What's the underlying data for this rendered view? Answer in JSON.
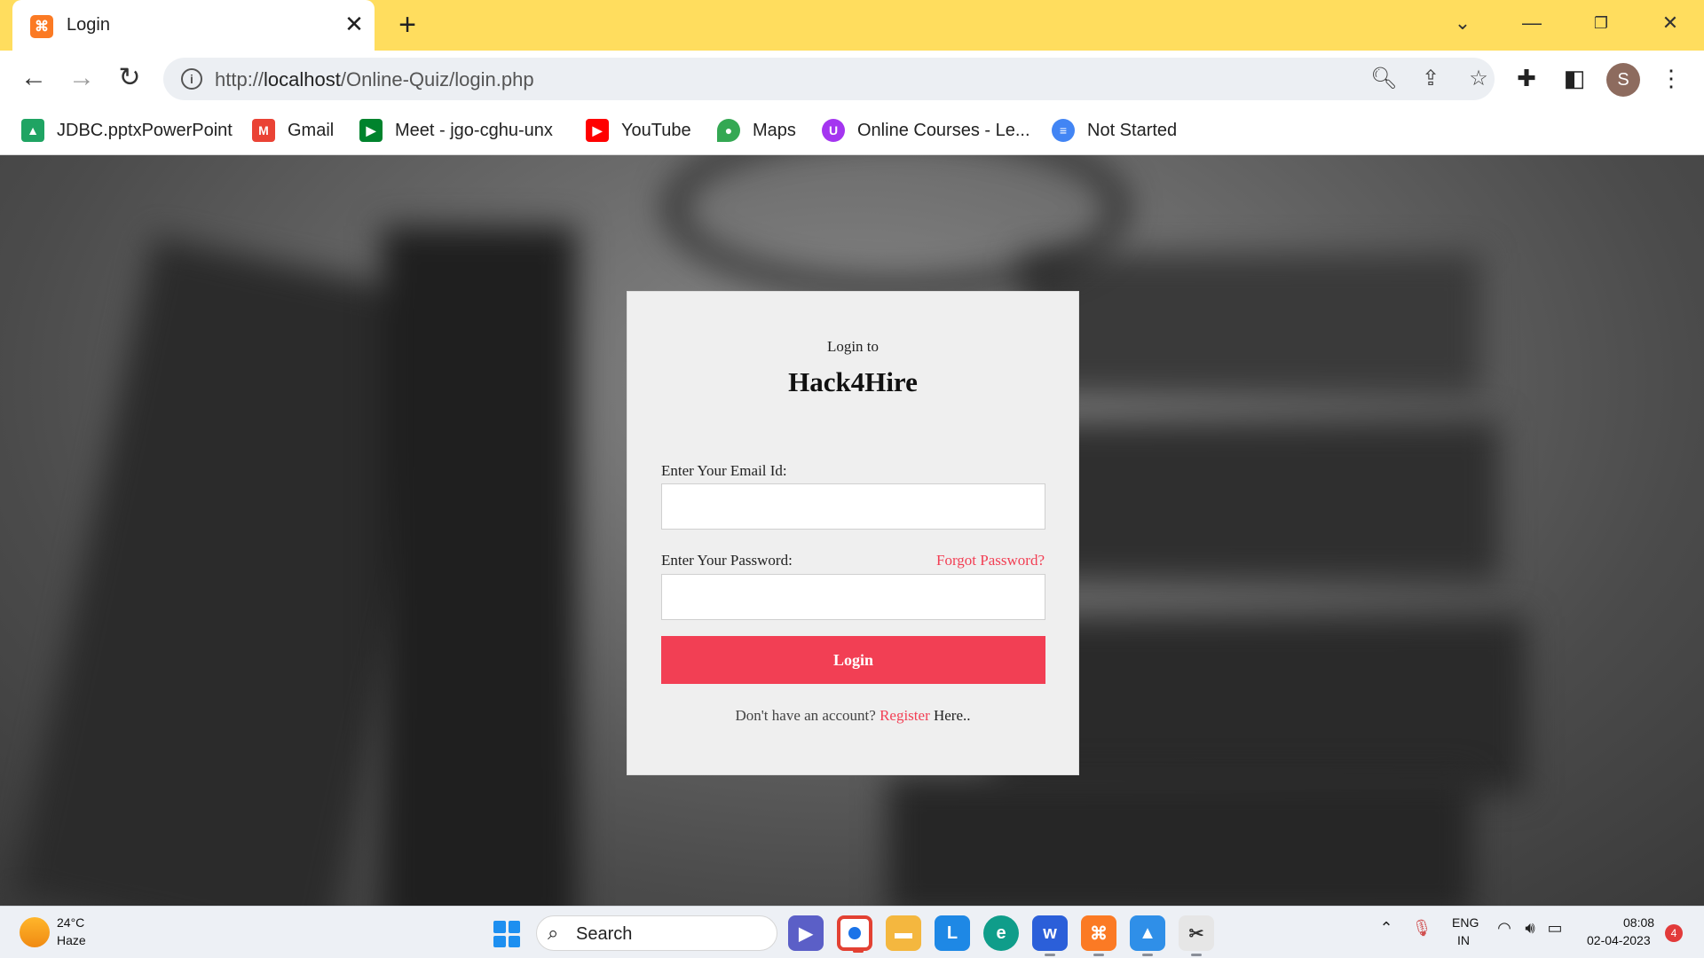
{
  "browser": {
    "tab": {
      "title": "Login",
      "favicon": "xampp-icon"
    },
    "address": {
      "scheme": "http://",
      "host": "localhost",
      "path": "/Online-Quiz/login.php"
    },
    "profile_initial": "S",
    "bookmarks": [
      {
        "label": "JDBC.pptxPowerPoint",
        "icon": "google-drive-icon",
        "color": "#1fa463"
      },
      {
        "label": "Gmail",
        "icon": "gmail-icon",
        "color": "#ea4335"
      },
      {
        "label": "Meet - jgo-cghu-unx",
        "icon": "google-meet-icon",
        "color": "#00832d"
      },
      {
        "label": "YouTube",
        "icon": "youtube-icon",
        "color": "#ff0000"
      },
      {
        "label": "Maps",
        "icon": "google-maps-icon",
        "color": "#34a853"
      },
      {
        "label": "Online Courses - Le...",
        "icon": "udemy-icon",
        "color": "#a435f0"
      },
      {
        "label": "Not Started",
        "icon": "google-docs-icon",
        "color": "#4285f4"
      }
    ]
  },
  "login": {
    "subtitle": "Login to",
    "title": "Hack4Hire",
    "email_label": "Enter Your Email Id:",
    "email_value": "",
    "password_label": "Enter Your Password:",
    "password_value": "",
    "forgot_link": "Forgot Password?",
    "submit_label": "Login",
    "no_account_text": "Don't have an account?",
    "register_link": "Register",
    "here_text": "Here..",
    "accent_color": "#f23f54"
  },
  "taskbar": {
    "weather_temp": "24°C",
    "weather_desc": "Haze",
    "search_label": "Search",
    "lang_line1": "ENG",
    "lang_line2": "IN",
    "time": "08:08",
    "date": "02-04-2023",
    "notification_count": "4"
  }
}
